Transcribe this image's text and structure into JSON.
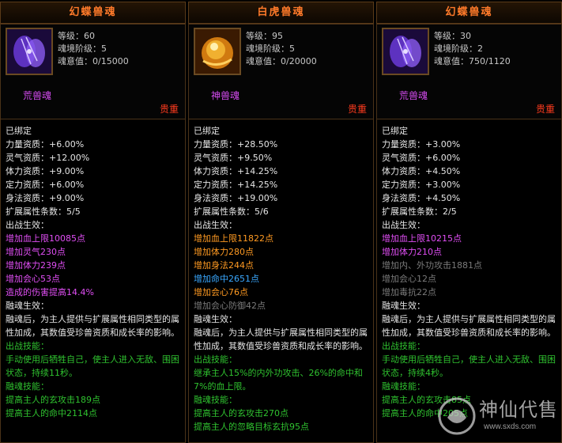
{
  "panels": [
    {
      "title": "幻蝶兽魂",
      "icon": "butterfly-icon",
      "level": "等级：60",
      "realm": "魂境阶级：5",
      "will": "魂意值：0/15000",
      "type": "荒兽魂",
      "precious": "贵重",
      "lines": [
        {
          "text": "已绑定",
          "color": "w"
        },
        {
          "text": "力量资质：+6.00%",
          "color": "w"
        },
        {
          "text": "灵气资质：+12.00%",
          "color": "w"
        },
        {
          "text": "体力资质：+9.00%",
          "color": "w"
        },
        {
          "text": "定力资质：+6.00%",
          "color": "w"
        },
        {
          "text": "身法资质：+9.00%",
          "color": "w"
        },
        {
          "text": "扩展属性条数：5/5",
          "color": "w"
        },
        {
          "text": "出战生效：",
          "color": "w"
        },
        {
          "text": "增加血上限10085点",
          "color": "p"
        },
        {
          "text": "增加灵气230点",
          "color": "p"
        },
        {
          "text": "增加体力239点",
          "color": "p"
        },
        {
          "text": "增加会心53点",
          "color": "p"
        },
        {
          "text": "造成的伤害提高14.4%",
          "color": "p"
        },
        {
          "text": "融魂生效：",
          "color": "w"
        },
        {
          "text": "融魂后，为主人提供与扩展属性相同类型的属性加成，其数值受珍兽资质和成长率的影响。",
          "color": "w",
          "wrap": true
        },
        {
          "text": "出战技能：",
          "color": "gr"
        },
        {
          "text": "手动使用后牺牲自己，使主人进入无敌、围困状态，持续11秒。",
          "color": "gr",
          "wrap": true
        },
        {
          "text": "融魂技能：",
          "color": "gr"
        },
        {
          "text": "提高主人的玄攻击189点",
          "color": "gr"
        },
        {
          "text": "提高主人的命中2114点",
          "color": "gr"
        }
      ]
    },
    {
      "title": "白虎兽魂",
      "icon": "white-tiger-icon",
      "level": "等级：95",
      "realm": "魂境阶级：5",
      "will": "魂意值：0/20000",
      "type": "神兽魂",
      "precious": "贵重",
      "lines": [
        {
          "text": "已绑定",
          "color": "w"
        },
        {
          "text": "力量资质：+28.50%",
          "color": "w"
        },
        {
          "text": "灵气资质：+9.50%",
          "color": "w"
        },
        {
          "text": "体力资质：+14.25%",
          "color": "w"
        },
        {
          "text": "定力资质：+14.25%",
          "color": "w"
        },
        {
          "text": "身法资质：+19.00%",
          "color": "w"
        },
        {
          "text": "扩展属性条数：5/6",
          "color": "w"
        },
        {
          "text": "出战生效：",
          "color": "w"
        },
        {
          "text": "增加血上限11822点",
          "color": "o"
        },
        {
          "text": "增加体力280点",
          "color": "o"
        },
        {
          "text": "增加身法244点",
          "color": "o"
        },
        {
          "text": "增加命中2651点",
          "color": "b"
        },
        {
          "text": "增加会心76点",
          "color": "o"
        },
        {
          "text": "增加会心防御42点",
          "color": "g"
        },
        {
          "text": "融魂生效：",
          "color": "w"
        },
        {
          "text": "融魂后，为主人提供与扩展属性相同类型的属性加成，其数值受珍兽资质和成长率的影响。",
          "color": "w",
          "wrap": true
        },
        {
          "text": "出战技能：",
          "color": "gr"
        },
        {
          "text": "继承主人15%的内外功攻击、26%的命中和7%的血上限。",
          "color": "gr",
          "wrap": true
        },
        {
          "text": "融魂技能：",
          "color": "gr"
        },
        {
          "text": "提高主人的玄攻击270点",
          "color": "gr"
        },
        {
          "text": "提高主人的忽略目标玄抗95点",
          "color": "gr"
        }
      ]
    },
    {
      "title": "幻蝶兽魂",
      "icon": "butterfly-icon",
      "level": "等级：30",
      "realm": "魂境阶级：2",
      "will": "魂意值：750/1120",
      "type": "荒兽魂",
      "precious": "贵重",
      "lines": [
        {
          "text": "已绑定",
          "color": "w"
        },
        {
          "text": "力量资质：+3.00%",
          "color": "w"
        },
        {
          "text": "灵气资质：+6.00%",
          "color": "w"
        },
        {
          "text": "体力资质：+4.50%",
          "color": "w"
        },
        {
          "text": "定力资质：+3.00%",
          "color": "w"
        },
        {
          "text": "身法资质：+4.50%",
          "color": "w"
        },
        {
          "text": "扩展属性条数：2/5",
          "color": "w"
        },
        {
          "text": "出战生效：",
          "color": "w"
        },
        {
          "text": "增加血上限10215点",
          "color": "p"
        },
        {
          "text": "增加体力210点",
          "color": "p"
        },
        {
          "text": "增加内、外功攻击1881点",
          "color": "g"
        },
        {
          "text": "增加会心12点",
          "color": "g"
        },
        {
          "text": "增加毒抗22点",
          "color": "g"
        },
        {
          "text": "融魂生效：",
          "color": "w"
        },
        {
          "text": "融魂后，为主人提供与扩展属性相同类型的属性加成，其数值受珍兽资质和成长率的影响。",
          "color": "w",
          "wrap": true
        },
        {
          "text": "出战技能：",
          "color": "gr"
        },
        {
          "text": "手动使用后牺牲自己，使主人进入无敌、围困状态，持续4秒。",
          "color": "gr",
          "wrap": true
        },
        {
          "text": "融魂技能：",
          "color": "gr"
        },
        {
          "text": "提高主人的玄攻击85点",
          "color": "gr"
        },
        {
          "text": "提高主人的命中205点",
          "color": "gr"
        }
      ]
    }
  ],
  "watermark": {
    "text": "神仙代售",
    "url": "www.sxds.com"
  }
}
